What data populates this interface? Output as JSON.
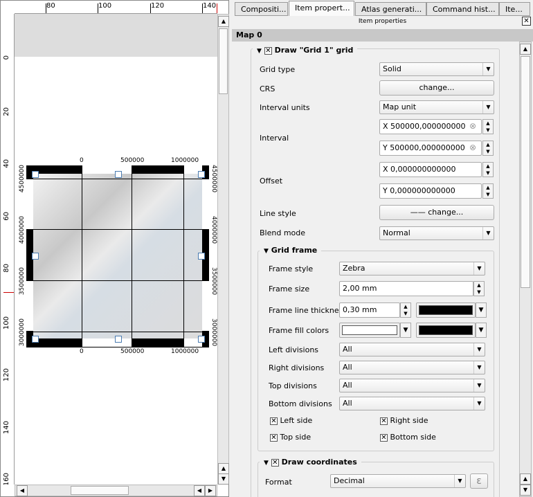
{
  "composer": {
    "hruler": [
      "80",
      "100",
      "120",
      "140"
    ],
    "vruler": [
      "0",
      "20",
      "40",
      "60",
      "80",
      "100",
      "120",
      "140",
      "160"
    ],
    "map": {
      "top_labels": [
        "0",
        "500000",
        "1000000"
      ],
      "bottom_labels": [
        "0",
        "500000",
        "1000000"
      ],
      "left_labels": [
        "4500000",
        "4000000",
        "3500000",
        "3000000"
      ],
      "right_labels": [
        "4500000",
        "4000000",
        "3500000",
        "3000000"
      ]
    }
  },
  "tabs": [
    {
      "label": "Compositi..."
    },
    {
      "label": "Item propert..."
    },
    {
      "label": "Atlas generati..."
    },
    {
      "label": "Command hist..."
    },
    {
      "label": "Ite..."
    }
  ],
  "panel_title": "Item properties",
  "item_header": "Map 0",
  "grid": {
    "title": "Draw \"Grid 1\" grid",
    "checked": true,
    "grid_type_label": "Grid type",
    "grid_type": "Solid",
    "crs_label": "CRS",
    "crs_button": "change...",
    "interval_units_label": "Interval units",
    "interval_units": "Map unit",
    "interval_label": "Interval",
    "interval_x": "X 500000,000000000",
    "interval_y": "Y 500000,000000000",
    "offset_label": "Offset",
    "offset_x": "X 0,000000000000",
    "offset_y": "Y 0,000000000000",
    "line_style_label": "Line style",
    "line_style_button": "—— change...",
    "blend_mode_label": "Blend mode",
    "blend_mode": "Normal"
  },
  "frame": {
    "title": "Grid frame",
    "frame_style_label": "Frame style",
    "frame_style": "Zebra",
    "frame_size_label": "Frame size",
    "frame_size": "2,00 mm",
    "frame_line_label": "Frame line thickness",
    "frame_line": "0,30 mm",
    "fill_label": "Frame fill colors",
    "left_div_label": "Left divisions",
    "left_div": "All",
    "right_div_label": "Right divisions",
    "right_div": "All",
    "top_div_label": "Top divisions",
    "top_div": "All",
    "bottom_div_label": "Bottom divisions",
    "bottom_div": "All",
    "left_side": "Left side",
    "right_side": "Right side",
    "top_side": "Top side",
    "bottom_side": "Bottom side",
    "colors": {
      "line": "#000000",
      "fill1": "#ffffff",
      "fill2": "#000000"
    }
  },
  "coords": {
    "title": "Draw coordinates",
    "format_label": "Format",
    "format": "Decimal",
    "expr_icon": "ε"
  }
}
